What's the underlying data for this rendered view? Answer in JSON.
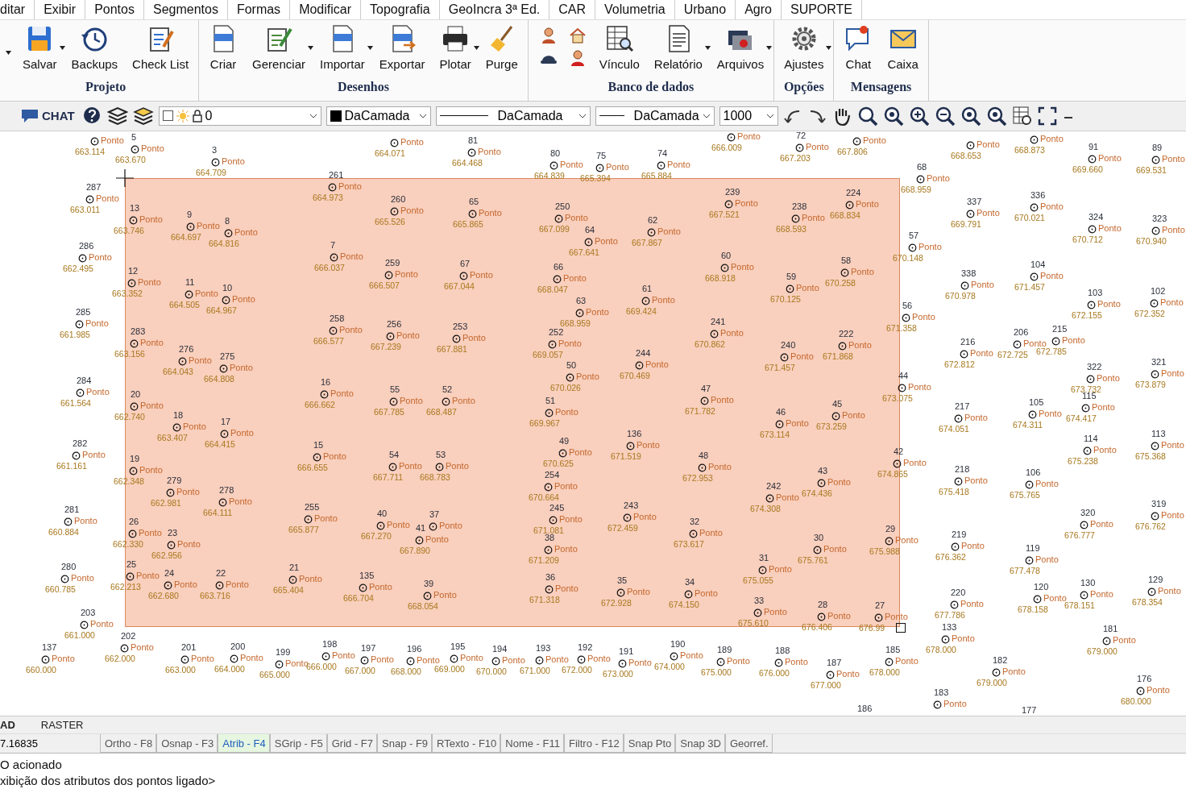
{
  "menu": [
    "ditar",
    "Exibir",
    "Pontos",
    "Segmentos",
    "Formas",
    "Modificar",
    "Topografia",
    "GeoIncra 3ª Ed.",
    "CAR",
    "Volumetria",
    "Urbano",
    "Agro",
    "SUPORTE"
  ],
  "ribbon": [
    {
      "title": "Projeto",
      "buttons": [
        {
          "kind": "large",
          "label": "Salvar",
          "dropdown": true
        },
        {
          "kind": "large",
          "label": "Backups",
          "dropdown": false
        },
        {
          "kind": "large",
          "label": "Check List",
          "dropdown": false
        }
      ]
    },
    {
      "title": "Desenhos",
      "buttons": [
        {
          "kind": "large",
          "label": "Criar",
          "dropdown": false
        },
        {
          "kind": "large",
          "label": "Gerenciar",
          "dropdown": true
        },
        {
          "kind": "large",
          "label": "Importar",
          "dropdown": true
        },
        {
          "kind": "large",
          "label": "Exportar",
          "dropdown": false
        },
        {
          "kind": "large",
          "label": "Plotar",
          "dropdown": true
        },
        {
          "kind": "large",
          "label": "Purge",
          "dropdown": false
        }
      ]
    },
    {
      "title": "Banco de dados",
      "buttons": [
        {
          "kind": "grid"
        },
        {
          "kind": "large",
          "label": "Vínculo",
          "dropdown": false
        },
        {
          "kind": "large",
          "label": "Relatório",
          "dropdown": true
        },
        {
          "kind": "large",
          "label": "Arquivos",
          "dropdown": true
        }
      ]
    },
    {
      "title": "Opções",
      "buttons": [
        {
          "kind": "large",
          "label": "Ajustes",
          "dropdown": true
        }
      ]
    },
    {
      "title": "Mensagens",
      "buttons": [
        {
          "kind": "large",
          "label": "Chat",
          "dropdown": false
        },
        {
          "kind": "large",
          "label": "Caixa",
          "dropdown": false
        }
      ]
    }
  ],
  "toolbar": {
    "chat": "CHAT",
    "layer": {
      "checked": false,
      "value": "0"
    },
    "entity_style": "DaCamada",
    "linetype": "DaCamada",
    "lineweight": "DaCamada",
    "scale": "1000"
  },
  "points": [
    {
      "label": "Ponto",
      "elevation": "663.114"
    },
    {
      "number": "5",
      "label": "Ponto",
      "elevation": "663.670"
    },
    {
      "number": "3",
      "label": "Ponto",
      "elevation": "664.709"
    },
    {
      "label": "Ponto",
      "elevation": "664.071"
    },
    {
      "number": "81",
      "label": "Ponto",
      "elevation": "664.468"
    },
    {
      "number": "80",
      "label": "Ponto",
      "elevation": "664.839"
    },
    {
      "number": "75",
      "label": "Ponto",
      "elevation": "665.394"
    },
    {
      "number": "74",
      "label": "Ponto",
      "elevation": "665.884"
    },
    {
      "label": "Ponto",
      "elevation": "666.009"
    },
    {
      "number": "72",
      "label": "Ponto",
      "elevation": "667.203"
    },
    {
      "label": "Ponto",
      "elevation": "667.806"
    },
    {
      "label": "Ponto",
      "elevation": "668.653"
    },
    {
      "label": "Ponto",
      "elevation": "668.873"
    },
    {
      "number": "91",
      "label": "Ponto",
      "elevation": "669.660"
    },
    {
      "number": "89",
      "label": "Ponto",
      "elevation": "669.531"
    },
    {
      "number": "68",
      "label": "Ponto",
      "elevation": "668.959"
    },
    {
      "number": "287",
      "label": "Ponto",
      "elevation": "663.011"
    },
    {
      "number": "261",
      "label": "Ponto",
      "elevation": "664.973"
    },
    {
      "number": "13",
      "label": "Ponto",
      "elevation": "663.746"
    },
    {
      "number": "9",
      "label": "Ponto",
      "elevation": "664.697"
    },
    {
      "number": "8",
      "label": "Ponto",
      "elevation": "664.816"
    },
    {
      "number": "260",
      "label": "Ponto",
      "elevation": "665.526"
    },
    {
      "number": "65",
      "label": "Ponto",
      "elevation": "665.865"
    },
    {
      "number": "250",
      "label": "Ponto",
      "elevation": "667.099"
    },
    {
      "number": "64",
      "label": "Ponto",
      "elevation": "667.641"
    },
    {
      "number": "62",
      "label": "Ponto",
      "elevation": "667.867"
    },
    {
      "number": "239",
      "label": "Ponto",
      "elevation": "667.521"
    },
    {
      "number": "238",
      "label": "Ponto",
      "elevation": "668.593"
    },
    {
      "number": "224",
      "label": "Ponto",
      "elevation": "668.834"
    },
    {
      "number": "337",
      "label": "Ponto",
      "elevation": "669.791"
    },
    {
      "number": "336",
      "label": "Ponto",
      "elevation": "670.021"
    },
    {
      "number": "324",
      "label": "Ponto",
      "elevation": "670.712"
    },
    {
      "number": "323",
      "label": "Ponto",
      "elevation": "670.940"
    },
    {
      "number": "57",
      "label": "Ponto",
      "elevation": "670.148"
    },
    {
      "number": "286",
      "label": "Ponto",
      "elevation": "662.495"
    },
    {
      "number": "7",
      "label": "Ponto",
      "elevation": "666.037"
    },
    {
      "number": "259",
      "label": "Ponto",
      "elevation": "666.507"
    },
    {
      "number": "67",
      "label": "Ponto",
      "elevation": "667.044"
    },
    {
      "number": "66",
      "label": "Ponto",
      "elevation": "668.047"
    },
    {
      "number": "60",
      "label": "Ponto",
      "elevation": "668.918"
    },
    {
      "number": "58",
      "label": "Ponto",
      "elevation": "670.258"
    },
    {
      "number": "59",
      "label": "Ponto",
      "elevation": "670.125"
    },
    {
      "number": "12",
      "label": "Ponto",
      "elevation": "663.352"
    },
    {
      "number": "11",
      "label": "Ponto",
      "elevation": "664.505"
    },
    {
      "number": "10",
      "label": "Ponto",
      "elevation": "664.967"
    },
    {
      "number": "63",
      "label": "Ponto",
      "elevation": "668.959"
    },
    {
      "number": "61",
      "label": "Ponto",
      "elevation": "669.424"
    },
    {
      "number": "338",
      "label": "Ponto",
      "elevation": "670.978"
    },
    {
      "number": "104",
      "label": "Ponto",
      "elevation": "671.457"
    },
    {
      "number": "103",
      "label": "Ponto",
      "elevation": "672.155"
    },
    {
      "number": "102",
      "label": "Ponto",
      "elevation": "672.352"
    },
    {
      "number": "56",
      "label": "Ponto",
      "elevation": "671.358"
    },
    {
      "number": "285",
      "label": "Ponto",
      "elevation": "661.985"
    },
    {
      "number": "258",
      "label": "Ponto",
      "elevation": "666.577"
    },
    {
      "number": "256",
      "label": "Ponto",
      "elevation": "667.239"
    },
    {
      "number": "253",
      "label": "Ponto",
      "elevation": "667.881"
    },
    {
      "number": "283",
      "label": "Ponto",
      "elevation": "663.156"
    },
    {
      "number": "276",
      "label": "Ponto",
      "elevation": "664.043"
    },
    {
      "number": "275",
      "label": "Ponto",
      "elevation": "664.808"
    },
    {
      "number": "252",
      "label": "Ponto",
      "elevation": "669.057"
    },
    {
      "number": "241",
      "label": "Ponto",
      "elevation": "670.862"
    },
    {
      "number": "240",
      "label": "Ponto",
      "elevation": "671.457"
    },
    {
      "number": "222",
      "label": "Ponto",
      "elevation": "671.868"
    },
    {
      "number": "216",
      "label": "Ponto",
      "elevation": "672.812"
    },
    {
      "number": "206",
      "label": "Ponto",
      "elevation": "672.725"
    },
    {
      "number": "215",
      "label": "Ponto",
      "elevation": "672.785"
    },
    {
      "number": "244",
      "label": "Ponto",
      "elevation": "670.469"
    },
    {
      "number": "50",
      "label": "Ponto",
      "elevation": "670.026"
    },
    {
      "number": "51",
      "label": "Ponto",
      "elevation": "669.967"
    },
    {
      "number": "47",
      "label": "Ponto",
      "elevation": "671.782"
    },
    {
      "number": "46",
      "label": "Ponto",
      "elevation": "673.114"
    },
    {
      "number": "45",
      "label": "Ponto",
      "elevation": "673.259"
    },
    {
      "number": "44",
      "label": "Ponto",
      "elevation": "673.075"
    },
    {
      "number": "322",
      "label": "Ponto",
      "elevation": "673.732"
    },
    {
      "number": "321",
      "label": "Ponto",
      "elevation": "673.879"
    },
    {
      "number": "115",
      "label": "Ponto",
      "elevation": "674.417"
    },
    {
      "number": "217",
      "label": "Ponto",
      "elevation": "674.051"
    },
    {
      "number": "105",
      "label": "Ponto",
      "elevation": "674.311"
    },
    {
      "number": "284",
      "label": "Ponto",
      "elevation": "661.564"
    },
    {
      "number": "16",
      "label": "Ponto",
      "elevation": "666.662"
    },
    {
      "number": "55",
      "label": "Ponto",
      "elevation": "667.785"
    },
    {
      "number": "52",
      "label": "Ponto",
      "elevation": "668.487"
    },
    {
      "number": "20",
      "label": "Ponto",
      "elevation": "662.740"
    },
    {
      "number": "18",
      "label": "Ponto",
      "elevation": "663.407"
    },
    {
      "number": "17",
      "label": "Ponto",
      "elevation": "664.415"
    },
    {
      "number": "282",
      "label": "Ponto",
      "elevation": "661.161"
    },
    {
      "number": "19",
      "label": "Ponto",
      "elevation": "662.348"
    },
    {
      "number": "15",
      "label": "Ponto",
      "elevation": "666.655"
    },
    {
      "number": "54",
      "label": "Ponto",
      "elevation": "667.711"
    },
    {
      "number": "53",
      "label": "Ponto",
      "elevation": "668.783"
    },
    {
      "number": "49",
      "label": "Ponto",
      "elevation": "670.625"
    },
    {
      "number": "136",
      "label": "Ponto",
      "elevation": "671.519"
    },
    {
      "number": "254",
      "label": "Ponto",
      "elevation": "670.664"
    },
    {
      "number": "48",
      "label": "Ponto",
      "elevation": "672.953"
    },
    {
      "number": "279",
      "label": "Ponto",
      "elevation": "662.981"
    },
    {
      "number": "278",
      "label": "Ponto",
      "elevation": "664.111"
    },
    {
      "number": "114",
      "label": "Ponto",
      "elevation": "675.238"
    },
    {
      "number": "113",
      "label": "Ponto",
      "elevation": "675.368"
    },
    {
      "number": "42",
      "label": "Ponto",
      "elevation": "674.865"
    },
    {
      "number": "43",
      "label": "Ponto",
      "elevation": "674.436"
    },
    {
      "number": "218",
      "label": "Ponto",
      "elevation": "675.418"
    },
    {
      "number": "106",
      "label": "Ponto",
      "elevation": "675.765"
    },
    {
      "number": "242",
      "label": "Ponto",
      "elevation": "674.308"
    },
    {
      "number": "281",
      "label": "Ponto",
      "elevation": "660.884"
    },
    {
      "number": "26",
      "label": "Ponto",
      "elevation": "662.330"
    },
    {
      "number": "23",
      "label": "Ponto",
      "elevation": "662.956"
    },
    {
      "number": "255",
      "label": "Ponto",
      "elevation": "665.877"
    },
    {
      "number": "40",
      "label": "Ponto",
      "elevation": "667.270"
    },
    {
      "number": "41",
      "label": "Ponto",
      "elevation": "667.890"
    },
    {
      "number": "37",
      "label": "Ponto"
    },
    {
      "number": "245",
      "label": "Ponto",
      "elevation": "671.081"
    },
    {
      "number": "243",
      "label": "Ponto",
      "elevation": "672.459"
    },
    {
      "number": "32",
      "label": "Ponto",
      "elevation": "673.617"
    },
    {
      "number": "319",
      "label": "Ponto",
      "elevation": "676.762"
    },
    {
      "number": "320",
      "label": "Ponto",
      "elevation": "676.777"
    },
    {
      "number": "38",
      "label": "Ponto",
      "elevation": "671.209"
    },
    {
      "number": "30",
      "label": "Ponto",
      "elevation": "675.761"
    },
    {
      "number": "29",
      "label": "Ponto",
      "elevation": "675.988"
    },
    {
      "number": "219",
      "label": "Ponto",
      "elevation": "676.362"
    },
    {
      "number": "119",
      "label": "Ponto",
      "elevation": "677.478"
    },
    {
      "number": "31",
      "label": "Ponto",
      "elevation": "675.055"
    },
    {
      "number": "280",
      "label": "Ponto",
      "elevation": "660.785"
    },
    {
      "number": "25",
      "label": "Ponto",
      "elevation": "662.213"
    },
    {
      "number": "24",
      "label": "Ponto",
      "elevation": "662.680"
    },
    {
      "number": "22",
      "label": "Ponto",
      "elevation": "663.716"
    },
    {
      "number": "21",
      "label": "Ponto",
      "elevation": "665.404"
    },
    {
      "number": "135",
      "label": "Ponto",
      "elevation": "666.704"
    },
    {
      "number": "39",
      "label": "Ponto",
      "elevation": "668.054"
    },
    {
      "number": "36",
      "label": "Ponto",
      "elevation": "671.318"
    },
    {
      "number": "35",
      "label": "Ponto",
      "elevation": "672.928"
    },
    {
      "number": "34",
      "label": "Ponto",
      "elevation": "674.150"
    },
    {
      "number": "120",
      "label": "Ponto",
      "elevation": "678.158"
    },
    {
      "number": "130",
      "label": "Ponto",
      "elevation": "678.151"
    },
    {
      "number": "129",
      "label": "Ponto",
      "elevation": "678.354"
    },
    {
      "number": "33",
      "label": "Ponto",
      "elevation": "675.610"
    },
    {
      "number": "28",
      "label": "Ponto",
      "elevation": "676.406"
    },
    {
      "number": "27",
      "label": "Ponto",
      "elevation": "676.99"
    },
    {
      "number": "220",
      "label": "Ponto",
      "elevation": "677.786"
    },
    {
      "number": "203",
      "label": "Ponto",
      "elevation": "661.000"
    },
    {
      "number": "133",
      "label": "Ponto",
      "elevation": "678.000"
    },
    {
      "number": "181",
      "label": "Ponto",
      "elevation": "679.000"
    },
    {
      "number": "137",
      "label": "Ponto",
      "elevation": "660.000"
    },
    {
      "number": "202",
      "label": "Ponto",
      "elevation": "662.000"
    },
    {
      "number": "201",
      "label": "Ponto",
      "elevation": "663.000"
    },
    {
      "number": "200",
      "label": "Ponto",
      "elevation": "664.000"
    },
    {
      "number": "199",
      "label": "Ponto",
      "elevation": "665.000"
    },
    {
      "number": "198",
      "label": "Ponto",
      "elevation": "666.000"
    },
    {
      "number": "197",
      "label": "Ponto",
      "elevation": "667.000"
    },
    {
      "number": "196",
      "label": "Ponto",
      "elevation": "668.000"
    },
    {
      "number": "195",
      "label": "Ponto",
      "elevation": "669.000"
    },
    {
      "number": "194",
      "label": "Ponto",
      "elevation": "670.000"
    },
    {
      "number": "193",
      "label": "Ponto",
      "elevation": "671.000"
    },
    {
      "number": "192",
      "label": "Ponto",
      "elevation": "672.000"
    },
    {
      "number": "191",
      "label": "Ponto",
      "elevation": "673.000"
    },
    {
      "number": "190",
      "label": "Ponto",
      "elevation": "674.000"
    },
    {
      "number": "189",
      "label": "Ponto",
      "elevation": "675.000"
    },
    {
      "number": "188",
      "label": "Ponto",
      "elevation": "676.000"
    },
    {
      "number": "187",
      "label": "Ponto",
      "elevation": "677.000"
    },
    {
      "number": "185",
      "label": "Ponto",
      "elevation": "678.000"
    },
    {
      "number": "182",
      "label": "Ponto",
      "elevation": "679.000"
    },
    {
      "number": "186"
    },
    {
      "number": "183",
      "label": "Ponto"
    },
    {
      "number": "177"
    },
    {
      "number": "176",
      "label": "Ponto",
      "elevation": "680.000"
    }
  ],
  "tabs": [
    {
      "label": "AD",
      "selected": true
    },
    {
      "label": "RASTER",
      "selected": false
    }
  ],
  "coordinate": "7.16835",
  "toggles": [
    {
      "label": "Ortho - F8",
      "on": false
    },
    {
      "label": "Osnap - F3",
      "on": false
    },
    {
      "label": "Atrib - F4",
      "on": true
    },
    {
      "label": "SGrip - F5",
      "on": false
    },
    {
      "label": "Grid - F7",
      "on": false
    },
    {
      "label": "Snap - F9",
      "on": false
    },
    {
      "label": "RTexto - F10",
      "on": false
    },
    {
      "label": "Nome - F11",
      "on": false
    },
    {
      "label": "Filtro - F12",
      "on": false
    },
    {
      "label": "Snap Pto",
      "on": false
    },
    {
      "label": "Snap 3D",
      "on": false
    },
    {
      "label": "Georref.",
      "on": false
    }
  ],
  "command_lines": [
    "O acionado",
    "xibição dos atributos dos pontos ligado>"
  ]
}
